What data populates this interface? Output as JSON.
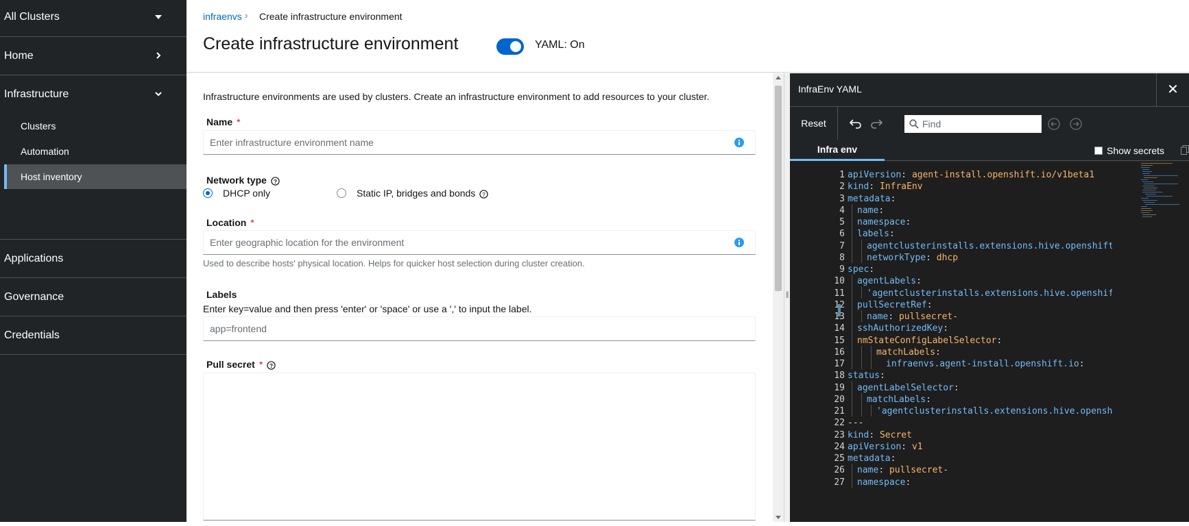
{
  "sidebar": {
    "cluster_switcher": "All Clusters",
    "sections": [
      {
        "label": "Home"
      },
      {
        "label": "Infrastructure",
        "items": [
          {
            "label": "Clusters"
          },
          {
            "label": "Automation"
          },
          {
            "label": "Host inventory",
            "active": true
          }
        ]
      },
      {
        "label": "Applications"
      },
      {
        "label": "Governance"
      },
      {
        "label": "Credentials"
      }
    ]
  },
  "header": {
    "breadcrumb_link": "infraenvs",
    "breadcrumb_current": "Create infrastructure environment",
    "title": "Create infrastructure environment",
    "yaml_toggle_label": "YAML: On",
    "yaml_toggle_on": true
  },
  "form": {
    "intro": "Infrastructure environments are used by clusters. Create an infrastructure environment to add resources to your cluster.",
    "name": {
      "label": "Name",
      "required": "*",
      "placeholder": "Enter infrastructure environment name",
      "value": ""
    },
    "network_type": {
      "label": "Network type",
      "options": [
        "DHCP only",
        "Static IP, bridges and bonds"
      ],
      "selected": "DHCP only"
    },
    "location": {
      "label": "Location",
      "required": "*",
      "placeholder": "Enter geographic location for the environment",
      "helper": "Used to describe hosts' physical location. Helps for quicker host selection during cluster creation."
    },
    "labels": {
      "label": "Labels",
      "description": "Enter key=value and then press 'enter' or 'space' or use a ',' to input the label.",
      "placeholder": "app=frontend"
    },
    "pull_secret": {
      "label": "Pull secret",
      "required": "*"
    }
  },
  "yaml": {
    "title": "InfraEnv YAML",
    "reset": "Reset",
    "find_placeholder": "Find",
    "tab": "Infra env",
    "show_secrets": "Show secrets",
    "show_secrets_checked": false,
    "lines": [
      {
        "n": "1",
        "indent": 0,
        "key": "apiVersion",
        "value": "agent-install.openshift.io/v1beta1",
        "vtype": "v"
      },
      {
        "n": "2",
        "indent": 0,
        "key": "kind",
        "value": "InfraEnv",
        "vtype": "v"
      },
      {
        "n": "3",
        "indent": 0,
        "key": "metadata",
        "value": "",
        "vtype": "v"
      },
      {
        "n": "4",
        "indent": 1,
        "key": "name",
        "value": "",
        "vtype": "v"
      },
      {
        "n": "5",
        "indent": 1,
        "key": "namespace",
        "value": "",
        "vtype": "v"
      },
      {
        "n": "6",
        "indent": 1,
        "key": "labels",
        "value": "",
        "vtype": "v"
      },
      {
        "n": "7",
        "indent": 2,
        "key": "agentclusterinstalls.extensions.hive.openshift.io/lo",
        "value": "",
        "vtype": "k",
        "nocolon": true
      },
      {
        "n": "8",
        "indent": 2,
        "key": "networkType",
        "value": "dhcp",
        "vtype": "v"
      },
      {
        "n": "9",
        "indent": 0,
        "key": "spec",
        "value": "",
        "vtype": "v"
      },
      {
        "n": "10",
        "indent": 1,
        "key": "agentLabels",
        "value": "",
        "vtype": "v"
      },
      {
        "n": "11",
        "indent": 2,
        "key": "",
        "value": "'agentclusterinstalls.extensions.hive.openshift.io/l",
        "vtype": "s",
        "nocolon": true
      },
      {
        "n": "12",
        "indent": 1,
        "key": "pullSecretRef",
        "value": "",
        "vtype": "v"
      },
      {
        "n": "13",
        "indent": 2,
        "key": "name",
        "value": "pullsecret-",
        "vtype": "v"
      },
      {
        "n": "14",
        "indent": 1,
        "key": "sshAuthorizedKey",
        "value": "",
        "vtype": "v"
      },
      {
        "n": "15",
        "indent": 1,
        "key": "nmStateConfigLabelSelector",
        "value": "",
        "vtype": "v",
        "keyclass": "v"
      },
      {
        "n": "16",
        "indent": 3,
        "key": "matchLabels",
        "value": "",
        "vtype": "v",
        "keyclass": "v"
      },
      {
        "n": "17",
        "indent": 4,
        "key": "infraenvs.agent-install.openshift.io",
        "value": "",
        "vtype": "v"
      },
      {
        "n": "18",
        "indent": 0,
        "key": "status",
        "value": "",
        "vtype": "v"
      },
      {
        "n": "19",
        "indent": 1,
        "key": "agentLabelSelector",
        "value": "",
        "vtype": "v"
      },
      {
        "n": "20",
        "indent": 2,
        "key": "matchLabels",
        "value": "",
        "vtype": "v"
      },
      {
        "n": "21",
        "indent": 3,
        "key": "",
        "value": "'agentclusterinstalls.extensions.hive.openshift.io",
        "vtype": "s",
        "nocolon": true
      },
      {
        "n": "22",
        "indent": 0,
        "key": "",
        "value": "---",
        "vtype": "p",
        "nocolon": true
      },
      {
        "n": "23",
        "indent": 0,
        "key": "kind",
        "value": "Secret",
        "vtype": "v"
      },
      {
        "n": "24",
        "indent": 0,
        "key": "apiVersion",
        "value": "v1",
        "vtype": "v"
      },
      {
        "n": "25",
        "indent": 0,
        "key": "metadata",
        "value": "",
        "vtype": "v"
      },
      {
        "n": "26",
        "indent": 1,
        "key": "name",
        "value": "pullsecret-",
        "vtype": "v"
      },
      {
        "n": "27",
        "indent": 1,
        "key": "namespace",
        "value": "",
        "vtype": "v"
      }
    ]
  },
  "colors": {
    "sidebar_bg": "#212427",
    "active_nav_bg": "#4f5255",
    "accent": "#0066cc",
    "required": "#c9190b",
    "yaml_key": "#73bcf7",
    "yaml_value": "#f4b66a"
  }
}
